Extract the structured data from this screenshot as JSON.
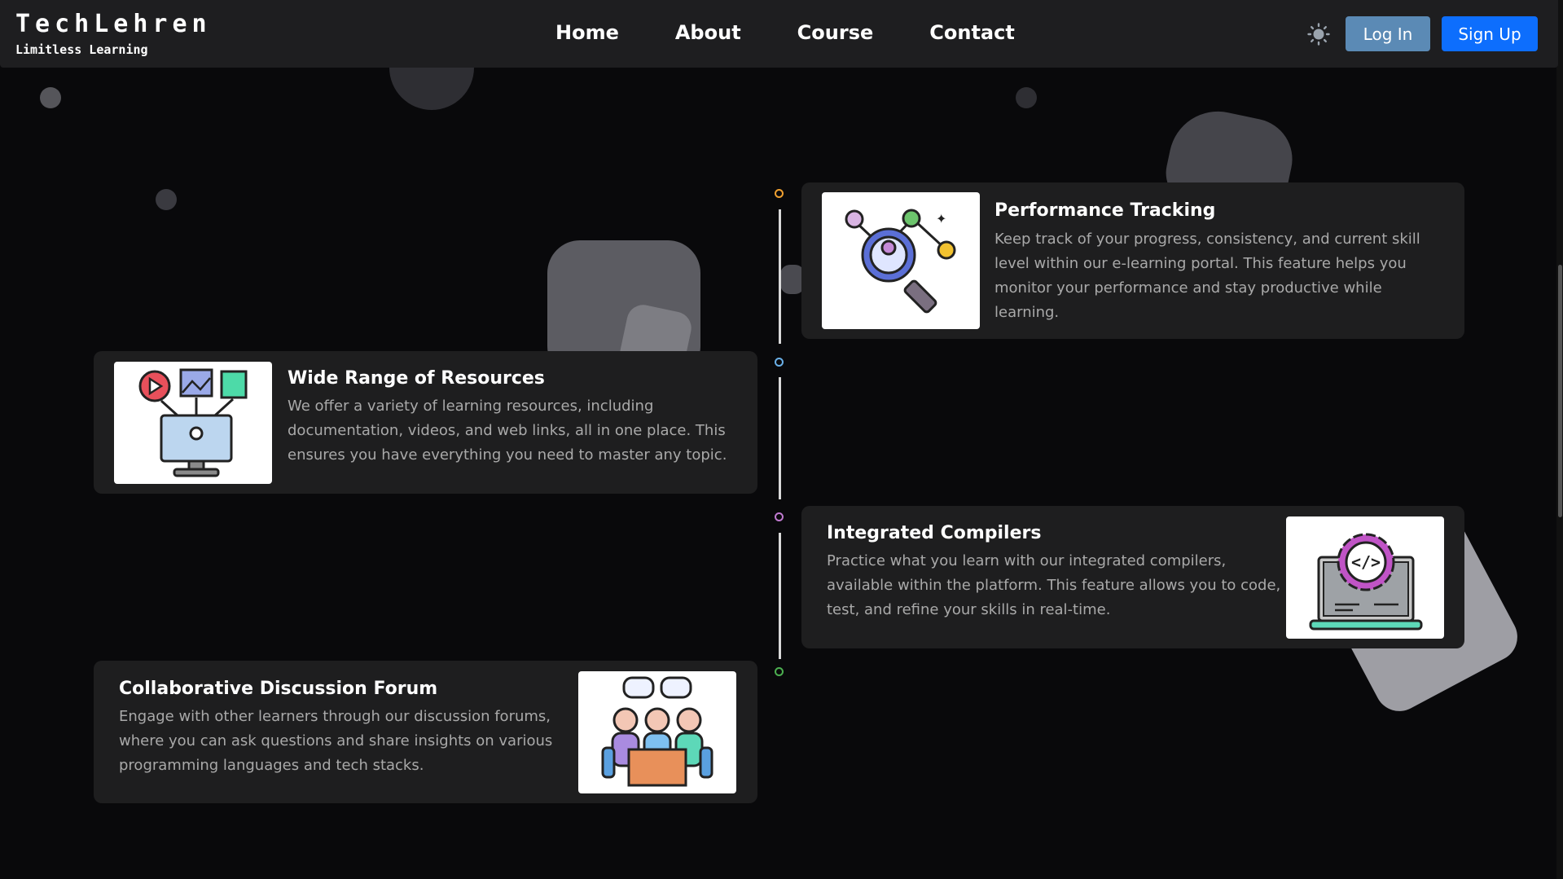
{
  "brand": {
    "title": "TechLehren",
    "subtitle": "Limitless Learning"
  },
  "nav": {
    "links": [
      "Home",
      "About",
      "Course",
      "Contact"
    ],
    "theme_icon": "sun-icon"
  },
  "auth": {
    "login_label": "Log In",
    "signup_label": "Sign Up"
  },
  "colors": {
    "login_bg": "#5b8ab5",
    "signup_bg": "#0d6efd",
    "page_bg": "#09090b",
    "card_bg": "#1e1e1f"
  },
  "timeline": {
    "dot_colors": [
      "#f0a030",
      "#6ab0e8",
      "#c07ad0",
      "#4caf50"
    ]
  },
  "features": [
    {
      "title": "Performance Tracking",
      "description": "Keep track of your progress, consistency, and current skill level within our e-learning portal. This feature helps you monitor your performance and stay productive while learning.",
      "icon": "analytics-magnifier-icon"
    },
    {
      "title": "Wide Range of Resources",
      "description": "We offer a variety of learning resources, including documentation, videos, and web links, all in one place. This ensures you have everything you need to master any topic.",
      "icon": "multimedia-monitor-icon"
    },
    {
      "title": "Integrated Compilers",
      "description": "Practice what you learn with our integrated compilers, available within the platform. This feature allows you to code, test, and refine your skills in real-time.",
      "icon": "code-gear-laptop-icon"
    },
    {
      "title": "Collaborative Discussion Forum",
      "description": "Engage with other learners through our discussion forums, where you can ask questions and share insights on various programming languages and tech stacks.",
      "icon": "team-discussion-icon"
    }
  ]
}
